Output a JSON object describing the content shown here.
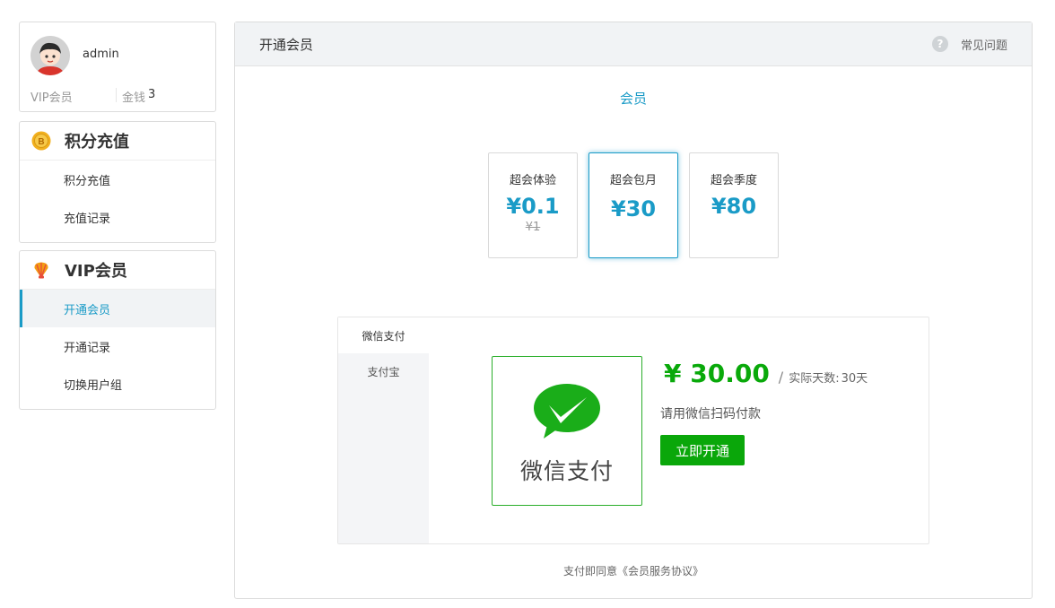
{
  "user": {
    "name": "admin",
    "level": "VIP会员",
    "money_label": "金钱",
    "money_value": "3"
  },
  "menus": {
    "points": {
      "title": "积分充值",
      "icon": "coin-b-icon",
      "items": [
        {
          "label": "积分充值"
        },
        {
          "label": "充值记录"
        }
      ]
    },
    "vip": {
      "title": "VIP会员",
      "icon": "shell-icon",
      "items": [
        {
          "label": "开通会员",
          "active": true
        },
        {
          "label": "开通记录"
        },
        {
          "label": "切换用户组"
        }
      ]
    }
  },
  "panel": {
    "title": "开通会员",
    "faq_label": "常见问题",
    "faq_icon": "question-icon",
    "section_title": "会员"
  },
  "plans": [
    {
      "name": "超会体验",
      "price": "¥0.1",
      "old_price": "¥1"
    },
    {
      "name": "超会包月",
      "price": "¥30",
      "selected": true
    },
    {
      "name": "超会季度",
      "price": "¥80"
    }
  ],
  "payment": {
    "tabs": [
      {
        "label": "微信支付",
        "active": true
      },
      {
        "label": "支付宝"
      }
    ],
    "qr_logo": "wechat-pay-icon",
    "qr_text": "微信支付",
    "amount": "¥ 30.00",
    "slash": "/",
    "days_label": "实际天数:",
    "days_value": "30天",
    "hint": "请用微信扫码付款",
    "button": "立即开通"
  },
  "agreement": {
    "prefix": "支付即同意",
    "link": "《会员服务协议》"
  },
  "colors": {
    "accent": "#1a9bc7",
    "wechat_green": "#09a90a",
    "panel_header_bg": "#f1f3f5"
  }
}
